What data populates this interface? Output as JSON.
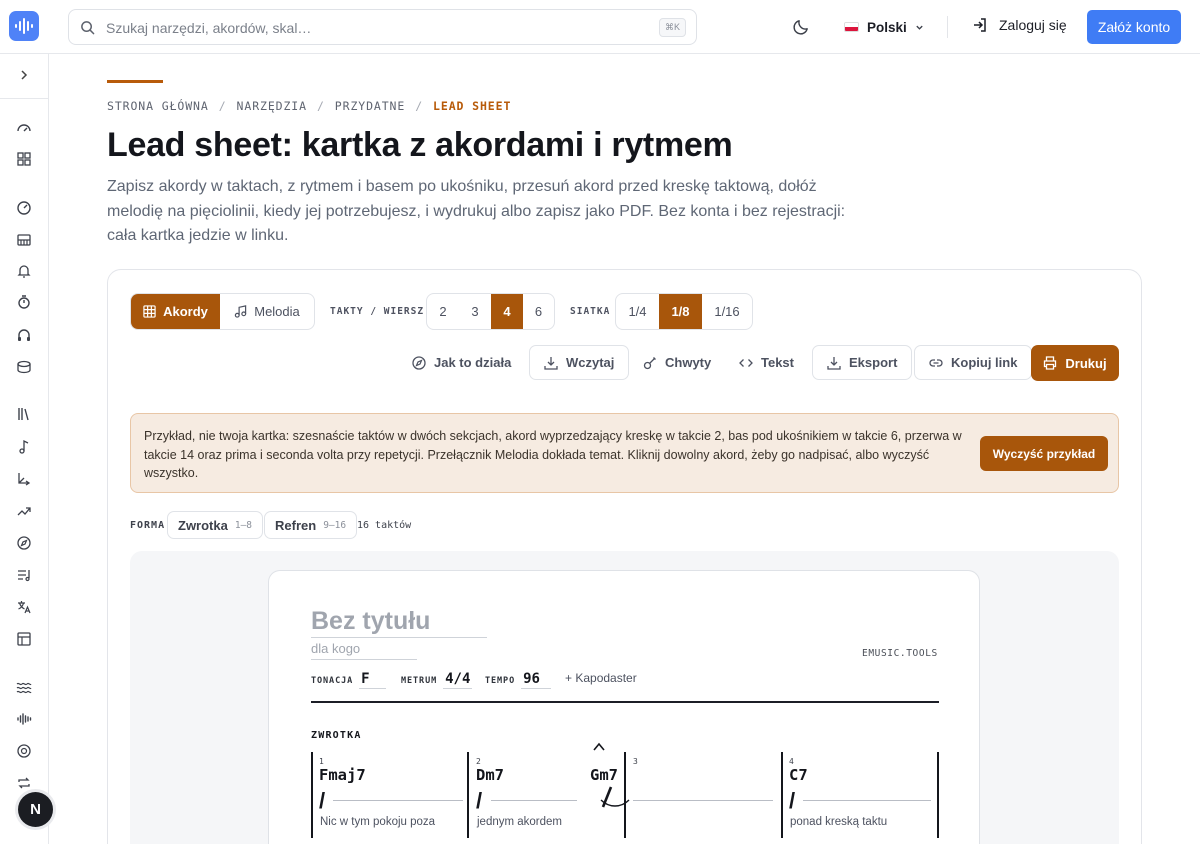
{
  "header": {
    "search_placeholder": "Szukaj narzędzi, akordów, skal…",
    "search_shortcut": "⌘K",
    "language": "Polski",
    "login": "Zaloguj się",
    "signup": "Załóż konto"
  },
  "sidebar": {
    "icons": [
      "expand-icon",
      "gauge-icon",
      "grid-icon",
      "metronome-icon",
      "piano-icon",
      "bell-icon",
      "timer-icon",
      "headphones-icon",
      "drum-icon",
      "library-icon",
      "note-icon",
      "interval-icon",
      "trend-icon",
      "compass-icon",
      "playlist-icon",
      "translate-icon",
      "table-icon",
      "waves-icon",
      "waveform-icon",
      "circle-icon",
      "repeat-icon"
    ],
    "avatar_letter": "N"
  },
  "breadcrumb": [
    "STRONA GŁÓWNA",
    "NARZĘDZIA",
    "PRZYDATNE",
    "LEAD SHEET"
  ],
  "page": {
    "title": "Lead sheet: kartka z akordami i rytmem",
    "lead": "Zapisz akordy w taktach, z rytmem i basem po ukośniku, przesuń akord przed kreskę taktową, dołóż melodię na pięciolinii, kiedy jej potrzebujesz, i wydrukuj albo zapisz jako PDF. Bez konta i bez rejestracji: cała kartka jedzie w linku."
  },
  "controls": {
    "mode": [
      {
        "label": "Akordy",
        "active": true
      },
      {
        "label": "Melodia",
        "active": false
      }
    ],
    "bars_per_row_label": "TAKTY / WIERSZ",
    "bars_per_row": [
      {
        "label": "2",
        "active": false
      },
      {
        "label": "3",
        "active": false
      },
      {
        "label": "4",
        "active": true
      },
      {
        "label": "6",
        "active": false
      }
    ],
    "grid_label": "SIATKA",
    "grid": [
      {
        "label": "1/4",
        "active": false
      },
      {
        "label": "1/8",
        "active": true
      },
      {
        "label": "1/16",
        "active": false
      }
    ],
    "tools": {
      "how": "Jak to działa",
      "load": "Wczytaj",
      "grips": "Chwyty",
      "text": "Tekst",
      "export": "Eksport",
      "copy_link": "Kopiuj link",
      "print": "Drukuj"
    }
  },
  "notice": {
    "text": "Przykład, nie twoja kartka: szesnaście taktów w dwóch sekcjach, akord wyprzedzający kreskę w takcie 2, bas pod ukośnikiem w takcie 6, przerwa w takcie 14 oraz prima i seconda volta przy repetycji. Przełącznik Melodia dokłada temat. Kliknij dowolny akord, żeby go nadpisać, albo wyczyść wszystko.",
    "button": "Wyczyść przykład"
  },
  "form": {
    "label": "FORMA",
    "sections": [
      {
        "name": "Zwrotka",
        "range": "1–8"
      },
      {
        "name": "Refren",
        "range": "9–16"
      }
    ],
    "total": "16 taktów"
  },
  "sheet": {
    "title_placeholder": "Bez tytułu",
    "for_placeholder": "dla kogo",
    "brand": "EMUSIC.TOOLS",
    "key_label": "TONACJA",
    "key": "F",
    "meter_label": "METRUM",
    "meter": "4/4",
    "tempo_label": "TEMPO",
    "tempo": "96",
    "capo": "+ Kapodaster",
    "section": "ZWROTKA",
    "measures": [
      {
        "num": "1",
        "chord": "Fmaj7",
        "lyric": "Nic w tym pokoju poza"
      },
      {
        "num": "2",
        "chord": "Dm7",
        "lyric": "jednym akordem",
        "push_chord": "Gm7"
      },
      {
        "num": "3",
        "chord": "",
        "lyric": ""
      },
      {
        "num": "4",
        "chord": "C7",
        "lyric": "ponad kreską taktu"
      }
    ]
  },
  "colors": {
    "accent": "#a8560b",
    "primary": "#3f7cf5",
    "notice_bg": "#f6ebe1"
  }
}
